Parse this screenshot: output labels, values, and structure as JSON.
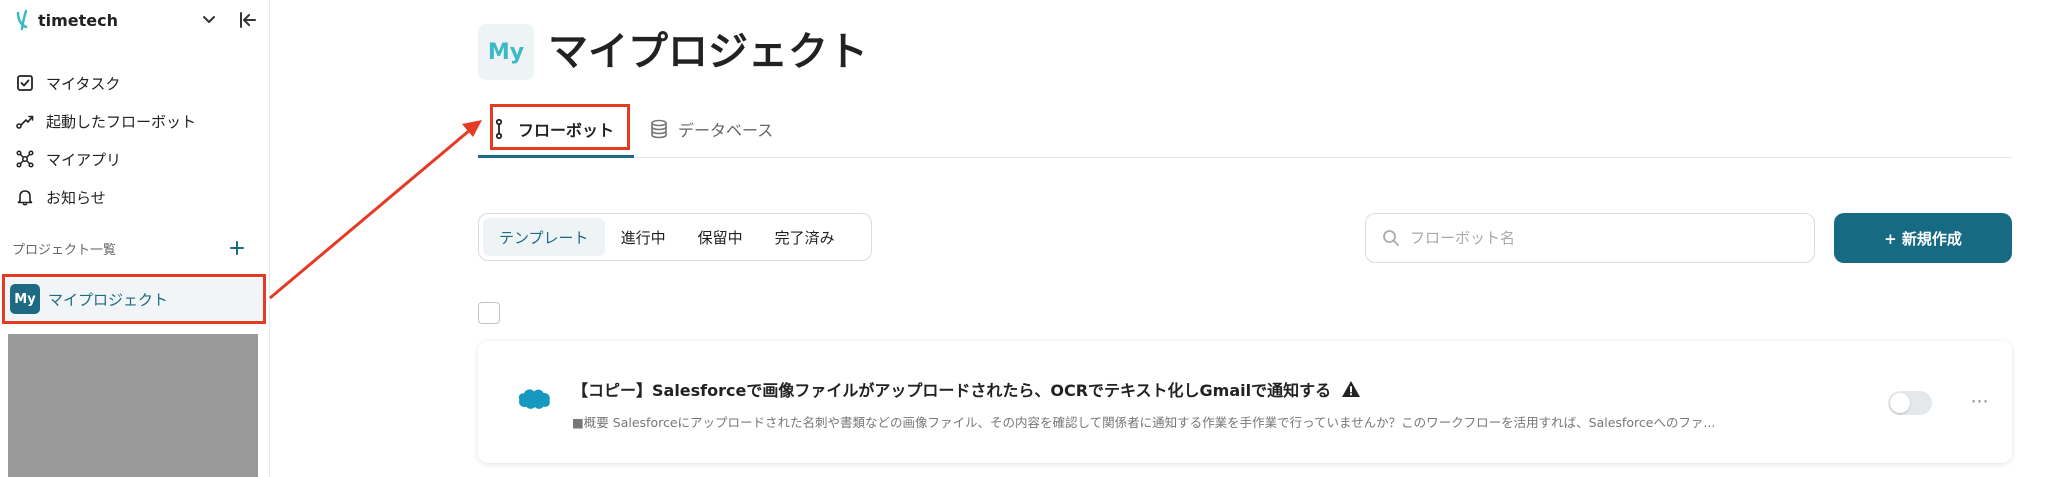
{
  "sidebar": {
    "brand": "timetech",
    "nav": [
      {
        "label": "マイタスク",
        "icon": "checkbox-icon"
      },
      {
        "label": "起動したフローボット",
        "icon": "flow-icon"
      },
      {
        "label": "マイアプリ",
        "icon": "apps-icon"
      },
      {
        "label": "お知らせ",
        "icon": "bell-icon"
      }
    ],
    "section_title": "プロジェクト一覧",
    "project": {
      "badge": "My",
      "label": "マイプロジェクト"
    }
  },
  "main": {
    "badge": "My",
    "title": "マイプロジェクト",
    "tabs": [
      {
        "label": "フローボット",
        "icon": "flowbot-icon",
        "active": true
      },
      {
        "label": "データベース",
        "icon": "database-icon",
        "active": false
      }
    ],
    "filters": [
      {
        "label": "テンプレート",
        "active": true
      },
      {
        "label": "進行中",
        "active": false
      },
      {
        "label": "保留中",
        "active": false
      },
      {
        "label": "完了済み",
        "active": false
      }
    ],
    "search_placeholder": "フローボット名",
    "new_button": "+ 新規作成",
    "card": {
      "title": "【コピー】Salesforceで画像ファイルがアップロードされたら、OCRでテキスト化しGmailで通知する",
      "description": "■概要 Salesforceにアップロードされた名刺や書類などの画像ファイル、その内容を確認して関係者に通知する作業を手作業で行っていませんか？このワークフローを活用すれば、Salesforceへのファ...",
      "enabled": false,
      "more": "⋯"
    }
  },
  "colors": {
    "accent": "#166a82",
    "highlight_red": "#e53a23",
    "badge_text": "#3bb9c6"
  }
}
